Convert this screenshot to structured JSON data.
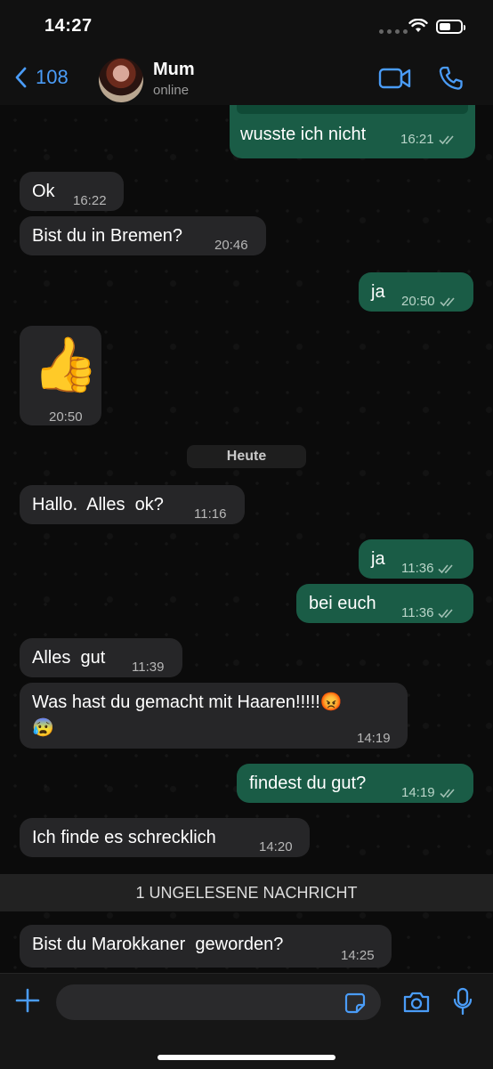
{
  "status_bar": {
    "time": "14:27"
  },
  "header": {
    "back_count": "108",
    "contact_name": "Mum",
    "contact_status": "online"
  },
  "messages": [
    {
      "dir": "out",
      "text": "wusste ich nicht",
      "time": "16:21"
    },
    {
      "dir": "in",
      "text": "Ok",
      "time": "16:22"
    },
    {
      "dir": "in",
      "text": "Bist du in Bremen?",
      "time": "20:46"
    },
    {
      "dir": "out",
      "text": "ja",
      "time": "20:50"
    },
    {
      "dir": "in",
      "text": "👍",
      "time": "20:50"
    },
    {
      "dir": "in",
      "text": "Hallo.  Alles  ok?",
      "time": "11:16"
    },
    {
      "dir": "out",
      "text": "ja",
      "time": "11:36"
    },
    {
      "dir": "out",
      "text": "bei euch",
      "time": "11:36"
    },
    {
      "dir": "in",
      "text": "Alles  gut",
      "time": "11:39"
    },
    {
      "dir": "in",
      "text": "Was hast du gemacht mit Haaren!!!!!😡",
      "text2": "😰",
      "time": "14:19"
    },
    {
      "dir": "out",
      "text": "findest du gut?",
      "time": "14:19"
    },
    {
      "dir": "in",
      "text": "Ich finde es schrecklich",
      "time": "14:20"
    },
    {
      "dir": "in",
      "text": "Bist du Marokkaner  geworden?",
      "time": "14:25"
    }
  ],
  "day_separator": "Heute",
  "unread_banner": "1 UNGELESENE NACHRICHT",
  "input": {
    "placeholder": ""
  },
  "icons": {
    "back": "chevron-left-icon",
    "video": "video-camera-icon",
    "call": "phone-icon",
    "plus": "plus-icon",
    "sticker": "sticker-icon",
    "camera": "camera-icon",
    "mic": "microphone-icon",
    "read": "double-check-icon"
  },
  "colors": {
    "accent": "#4a9cf7",
    "outgoing_bubble": "#1a5c46",
    "incoming_bubble": "#262628"
  }
}
